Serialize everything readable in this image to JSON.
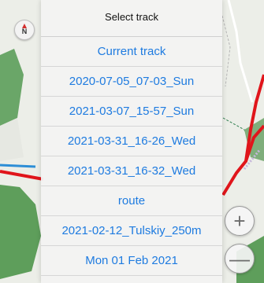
{
  "map": {
    "compass_letter": "N",
    "zoom_in_label": "+",
    "zoom_out_label": "—"
  },
  "track_picker": {
    "title": "Select track",
    "items": [
      "Current track",
      "2020-07-05_07-03_Sun",
      "2021-03-07_15-57_Sun",
      "2021-03-31_16-26_Wed",
      "2021-03-31_16-32_Wed",
      "route",
      "2021-02-12_Tulskiy_250m",
      "Mon 01 Feb 2021"
    ]
  },
  "colors": {
    "accent": "#1e7be0",
    "track_line": "#e0151b",
    "park_green": "#5e9e5b",
    "water_blue": "#2d8ed6"
  }
}
